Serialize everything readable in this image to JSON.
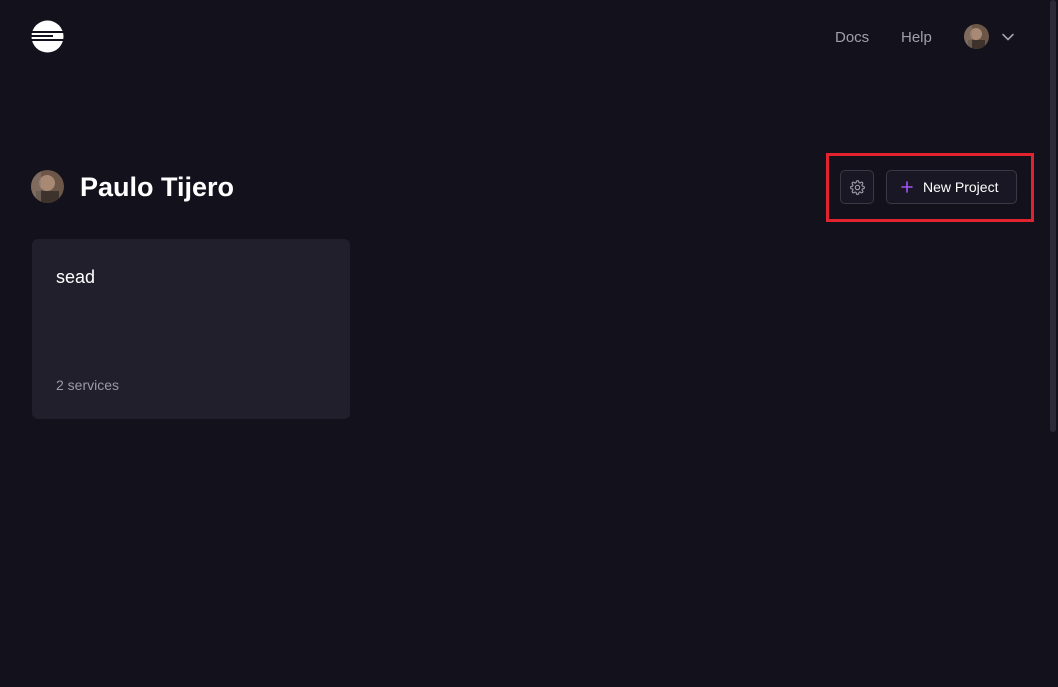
{
  "header": {
    "logo_icon": "railway-logo-icon",
    "nav": {
      "docs_label": "Docs",
      "help_label": "Help"
    },
    "user_menu": {
      "avatar_icon": "avatar",
      "chevron_icon": "chevron-down-icon"
    }
  },
  "profile": {
    "name": "Paulo Tijero",
    "avatar_icon": "avatar"
  },
  "actions": {
    "settings_icon": "gear-icon",
    "new_project_icon": "plus-icon",
    "new_project_label": "New Project",
    "plus_color": "#a155f5"
  },
  "projects": [
    {
      "name": "sead",
      "services": "2 services"
    }
  ],
  "colors": {
    "background": "#13111c",
    "card": "#211f2c",
    "highlight": "#e0232f"
  }
}
